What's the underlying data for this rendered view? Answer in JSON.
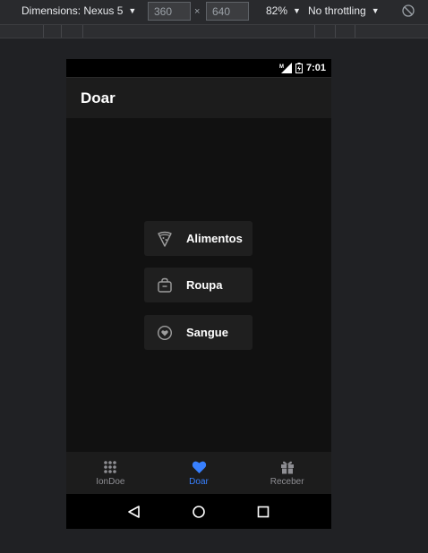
{
  "devtools": {
    "dimensions_label": "Dimensions: Nexus 5",
    "width_value": "360",
    "height_value": "640",
    "times": "×",
    "zoom": "82%",
    "throttling": "No throttling",
    "caret": "▼"
  },
  "status_bar": {
    "time": "7:01",
    "network": "M"
  },
  "app_bar": {
    "title": "Doar"
  },
  "donate_options": [
    {
      "label": "Alimentos",
      "icon": "pizza-icon"
    },
    {
      "label": "Roupa",
      "icon": "bag-icon"
    },
    {
      "label": "Sangue",
      "icon": "heart-circle-icon"
    }
  ],
  "tabs": [
    {
      "label": "IonDoe",
      "icon": "apps-icon",
      "active": false
    },
    {
      "label": "Doar",
      "icon": "heart-icon",
      "active": true
    },
    {
      "label": "Receber",
      "icon": "gift-icon",
      "active": false
    }
  ],
  "colors": {
    "accent": "#3880ff",
    "inactive_tab": "#8e8e93",
    "background": "#111111",
    "button_bg": "#1f1f1f"
  }
}
